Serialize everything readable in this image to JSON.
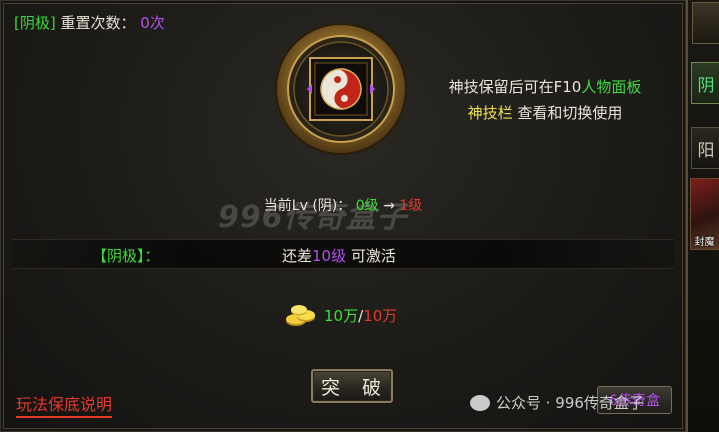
{
  "header": {
    "tag": "[阴极]",
    "reset_label": "重置次数：",
    "reset_count": "0次"
  },
  "skill": {
    "emblem": "yin-yang-icon",
    "desc_line1_pre": "神技保留后可在F10",
    "desc_line1_highlight": "人物面板",
    "desc_line2_highlight": "神技栏",
    "desc_line2_post": " 查看和切换使用"
  },
  "level": {
    "prefix": "当前Lv (阴)：",
    "current": "0级",
    "arrow": "→",
    "next": "1级"
  },
  "watermark": "996传奇盒子",
  "requirement": {
    "label": "【阴极】：",
    "text_pre": "还差",
    "amount": "10级",
    "text_post": "可激活"
  },
  "cost": {
    "icon": "gold-coins-icon",
    "have": "10万",
    "separator": "/",
    "need": "10万"
  },
  "buttons": {
    "break": "突 破",
    "rules": "玩法保底说明",
    "preview": "6传奇盒"
  },
  "sidebar": {
    "tabs": [
      {
        "label": "阴",
        "active": true
      },
      {
        "label": "阳",
        "active": false
      }
    ],
    "art_label": "封魔"
  },
  "footer": {
    "wechat": "公众号 · 996传奇盒子"
  },
  "colors": {
    "green": "#3ddd3a",
    "yellow": "#f1e24a",
    "red": "#e33a2a",
    "purple": "#b64ef0"
  }
}
